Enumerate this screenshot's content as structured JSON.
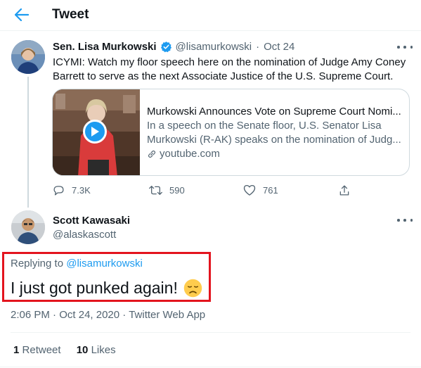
{
  "header": {
    "title": "Tweet",
    "back_icon": "arrow-left-icon"
  },
  "colors": {
    "accent": "#1d9bf0",
    "secondary_text": "#536471",
    "highlight_box": "#e3141e",
    "verified": "#1d9bf0"
  },
  "tweet1": {
    "name": "Sen. Lisa Murkowski",
    "verified": true,
    "handle": "@lisamurkowski",
    "separator": "·",
    "date": "Oct 24",
    "text": "ICYMI: Watch my floor speech here on the nomination of Judge Amy Coney Barrett to serve as the next Associate Justice of the U.S. Supreme Court.",
    "card": {
      "title": "Murkowski Announces Vote on Supreme Court Nomi...",
      "description": "In a speech on the Senate floor, U.S. Senator Lisa Murkowski (R-AK) speaks on the nomination of Judg...",
      "domain": "youtube.com"
    },
    "actions": {
      "replies": "7.3K",
      "retweets": "590",
      "likes": "761"
    }
  },
  "tweet2": {
    "name": "Scott Kawasaki",
    "handle": "@alaskascott",
    "replying_prefix": "Replying to",
    "replying_to": "@lisamurkowski",
    "text": "I just got punked again!",
    "emoji": "disappointed-face",
    "time": "2:06 PM",
    "date": "Oct 24, 2020",
    "source": "Twitter Web App",
    "separator": "·",
    "retweet_count": "1",
    "retweet_label": "Retweet",
    "like_count": "10",
    "like_label": "Likes"
  }
}
